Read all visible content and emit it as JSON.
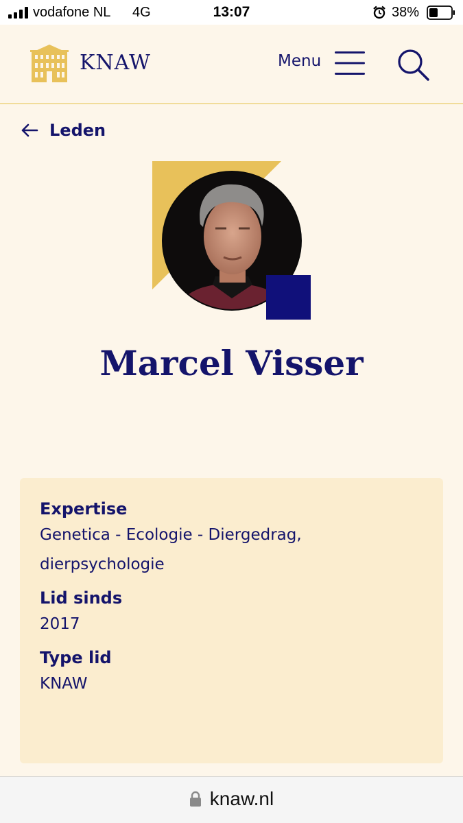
{
  "status_bar": {
    "carrier": "vodafone NL",
    "network": "4G",
    "time": "13:07",
    "battery_percent": "38%",
    "icons": [
      "signal-icon",
      "alarm-icon",
      "battery-icon"
    ]
  },
  "header": {
    "logo_text": "KNAW",
    "menu_label": "Menu",
    "icons": [
      "logo-building-icon",
      "hamburger-icon",
      "search-icon"
    ]
  },
  "back_link": {
    "label": "Leden",
    "icon": "arrow-left-icon"
  },
  "member": {
    "name": "Marcel Visser",
    "photo": "portrait-photo"
  },
  "details": {
    "expertise_label": "Expertise",
    "expertise_value": "Genetica - Ecologie - Diergedrag, dierpsychologie",
    "member_since_label": "Lid sinds",
    "member_since_value": "2017",
    "member_type_label": "Type lid",
    "member_type_value": "KNAW"
  },
  "browser": {
    "url": "knaw.nl",
    "icon": "lock-icon"
  },
  "colors": {
    "navy": "#14146b",
    "gold": "#e8c15a",
    "background": "#fdf6ea",
    "card": "#fbedcf"
  }
}
